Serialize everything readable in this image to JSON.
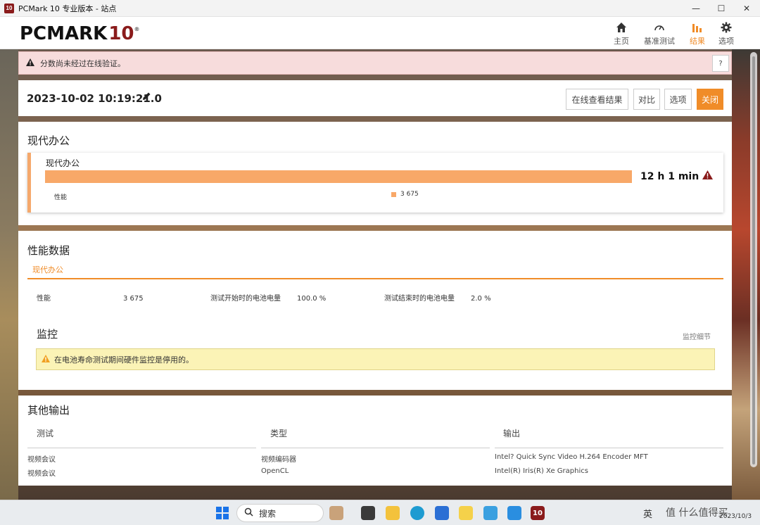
{
  "window": {
    "title": "PCMark 10 专业版本 - 站点",
    "app_icon_text": "10"
  },
  "header": {
    "logo_main": "PCMARK",
    "logo_num": "10",
    "logo_reg": "®",
    "nav": [
      {
        "label": "主页",
        "icon": "home-icon"
      },
      {
        "label": "基准测试",
        "icon": "gauge-icon"
      },
      {
        "label": "结果",
        "icon": "bar-chart-icon",
        "active": true
      },
      {
        "label": "选项",
        "icon": "gear-icon"
      }
    ]
  },
  "alert": {
    "text": "分数尚未经过在线验证。",
    "help": "?"
  },
  "result": {
    "date": "2023-10-02 10:19:21.0",
    "buttons": {
      "view_online": "在线查看结果",
      "compare": "对比",
      "options": "选项",
      "close": "关闭"
    }
  },
  "modern_office": {
    "section_title": "现代办公",
    "card_label": "现代办公",
    "score": "12 h 1 min",
    "perf_label": "性能",
    "perf_value": "3 675"
  },
  "perf_data": {
    "title": "性能数据",
    "tab": "现代办公",
    "items": [
      {
        "key": "性能",
        "value": "3 675"
      },
      {
        "key": "测试开始时的电池电量",
        "value": "100.0 %"
      },
      {
        "key": "测试结束时的电池电量",
        "value": "2.0 %"
      }
    ],
    "monitor_title": "监控",
    "monitor_link": "监控细节",
    "monitor_warning": "在电池寿命测试期间硬件监控是停用的。"
  },
  "other_output": {
    "title": "其他输出",
    "columns": [
      "测试",
      "类型",
      "输出"
    ],
    "rows": [
      [
        "视频会议",
        "视频编码器",
        "Intel? Quick Sync Video H.264 Encoder MFT"
      ],
      [
        "视频会议",
        "OpenCL",
        "Intel(R) Iris(R) Xe Graphics"
      ]
    ]
  },
  "taskbar": {
    "search_label": "搜索",
    "lang": "英",
    "date": "2023/10/3",
    "watermark": "值 什么值得买"
  },
  "colors": {
    "accent": "#f08c28",
    "bar": "#f8a868",
    "brand": "#8a1b1b"
  }
}
